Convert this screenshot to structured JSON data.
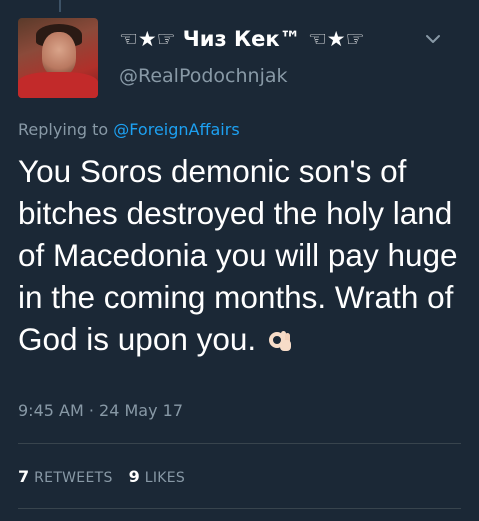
{
  "tweet": {
    "display_name": "☜★☞ Чиз Кек™ ☜★☞",
    "handle": "@RealPodochnjak",
    "reply_prefix": "Replying to",
    "reply_to": "@ForeignAffairs",
    "text": "You Soros demonic son's of bitches destroyed the holy land of Macedonia you will pay huge in the coming months. Wrath of God is upon you.",
    "emoji": "ok-hand",
    "timestamp": "9:45 AM · 24 May 17",
    "retweets_count": "7",
    "retweets_label": "RETWEETS",
    "likes_count": "9",
    "likes_label": "LIKES"
  },
  "colors": {
    "background": "#1b2836",
    "text_primary": "#ffffff",
    "text_secondary": "#8899a6",
    "link": "#1da1f2",
    "divider": "#38444d"
  },
  "icons": [
    "chevron-down-icon",
    "ok-hand-emoji-icon"
  ]
}
